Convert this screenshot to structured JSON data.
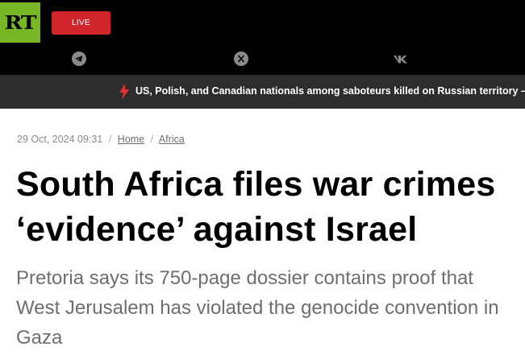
{
  "header": {
    "logo_text": "RT",
    "live_label": "LIVE",
    "social_icons": [
      "telegram-icon",
      "x-icon",
      "vk-icon"
    ]
  },
  "ticker": {
    "icon": "lightning-icon",
    "text": "US, Polish, and Canadian nationals among saboteurs killed on Russian territory –"
  },
  "article": {
    "timestamp": "29 Oct, 2024 09:31",
    "breadcrumb": [
      "Home",
      "Africa"
    ],
    "title_line1": "South Africa files war crimes",
    "title_line2": "‘evidence’ against Israel",
    "lead": "Pretoria says its 750-page dossier contains proof that West Jerusalem has violated the genocide convention in Gaza"
  },
  "colors": {
    "brand_green": "#77b726",
    "live_red": "#d0252b",
    "ticker_bg": "#2d2d2d",
    "bolt_red": "#e4312f"
  }
}
